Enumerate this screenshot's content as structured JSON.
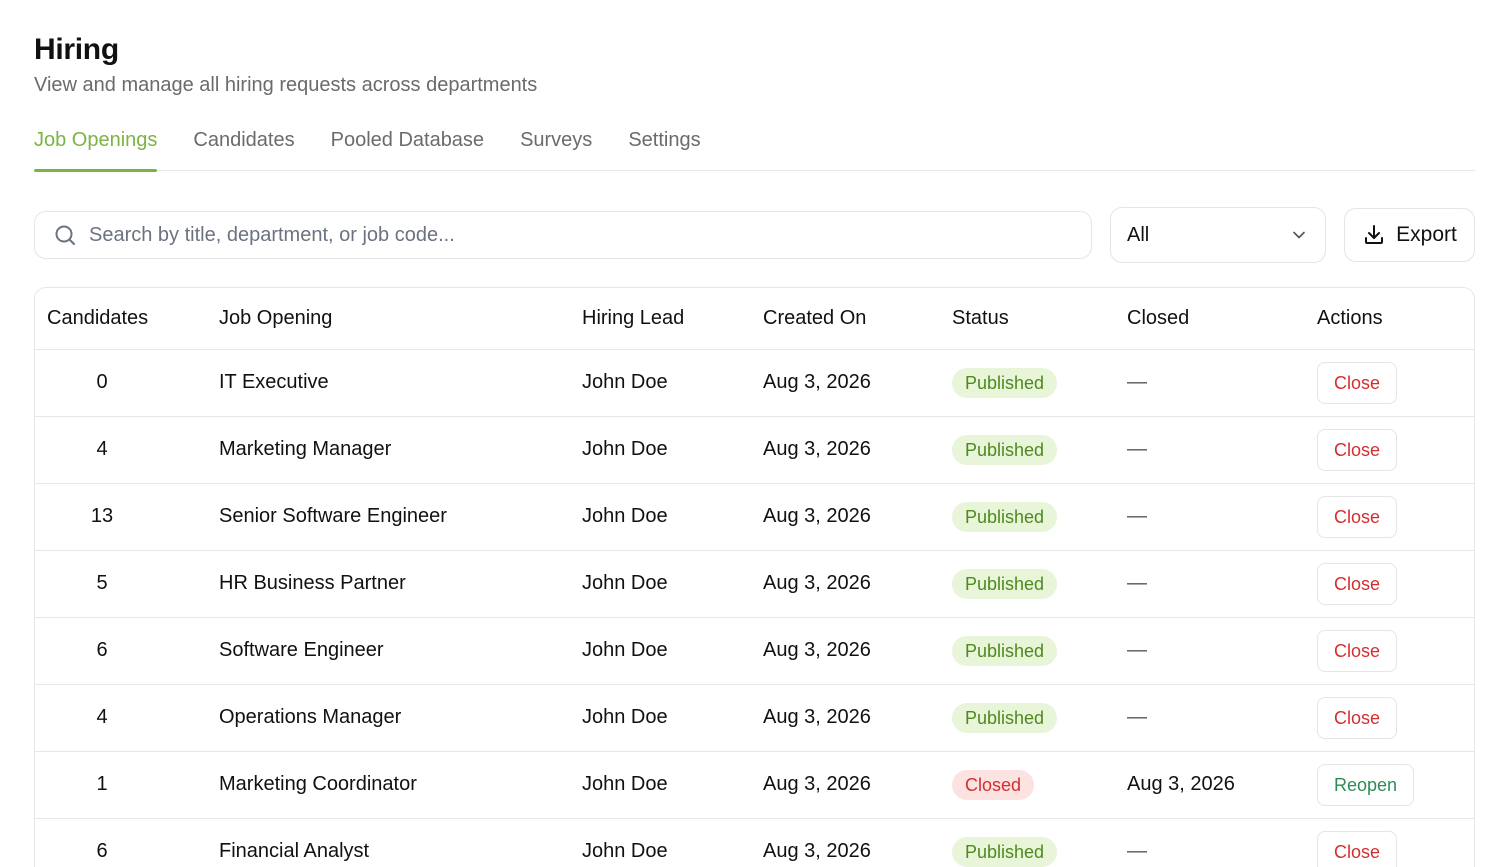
{
  "header": {
    "title": "Hiring",
    "subtitle": "View and manage all hiring requests across departments"
  },
  "tabs": [
    {
      "label": "Job Openings",
      "active": true
    },
    {
      "label": "Candidates",
      "active": false
    },
    {
      "label": "Pooled Database",
      "active": false
    },
    {
      "label": "Surveys",
      "active": false
    },
    {
      "label": "Settings",
      "active": false
    }
  ],
  "search": {
    "placeholder": "Search by title, department, or job code...",
    "value": ""
  },
  "filter": {
    "selected": "All"
  },
  "export": {
    "label": "Export"
  },
  "colors": {
    "accent": "#7cb342",
    "published_text": "#4e8a1e",
    "closed_text": "#d32f2f",
    "reopen_text": "#2e8b57"
  },
  "table": {
    "headers": {
      "candidates": "Candidates",
      "job_opening": "Job Opening",
      "hiring_lead": "Hiring Lead",
      "created_on": "Created On",
      "status": "Status",
      "closed": "Closed",
      "actions": "Actions"
    },
    "rows": [
      {
        "candidates": "0",
        "job": "IT Executive",
        "lead": "John Doe",
        "created": "Aug 3, 2026",
        "status": "Published",
        "closed": "—",
        "action": "Close"
      },
      {
        "candidates": "4",
        "job": "Marketing Manager",
        "lead": "John Doe",
        "created": "Aug 3, 2026",
        "status": "Published",
        "closed": "—",
        "action": "Close"
      },
      {
        "candidates": "13",
        "job": "Senior Software Engineer",
        "lead": "John Doe",
        "created": "Aug 3, 2026",
        "status": "Published",
        "closed": "—",
        "action": "Close"
      },
      {
        "candidates": "5",
        "job": "HR Business Partner",
        "lead": "John Doe",
        "created": "Aug 3, 2026",
        "status": "Published",
        "closed": "—",
        "action": "Close"
      },
      {
        "candidates": "6",
        "job": "Software Engineer",
        "lead": "John Doe",
        "created": "Aug 3, 2026",
        "status": "Published",
        "closed": "—",
        "action": "Close"
      },
      {
        "candidates": "4",
        "job": "Operations Manager",
        "lead": "John Doe",
        "created": "Aug 3, 2026",
        "status": "Published",
        "closed": "—",
        "action": "Close"
      },
      {
        "candidates": "1",
        "job": "Marketing Coordinator",
        "lead": "John Doe",
        "created": "Aug 3, 2026",
        "status": "Closed",
        "closed": "Aug 3, 2026",
        "action": "Reopen"
      },
      {
        "candidates": "6",
        "job": "Financial Analyst",
        "lead": "John Doe",
        "created": "Aug 3, 2026",
        "status": "Published",
        "closed": "—",
        "action": "Close"
      }
    ]
  }
}
